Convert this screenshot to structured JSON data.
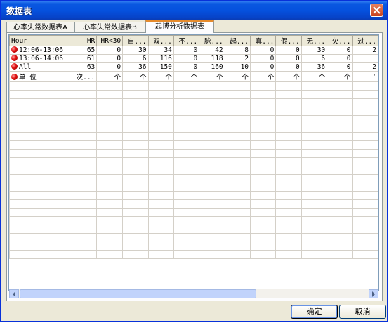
{
  "window": {
    "title": "数据表"
  },
  "tabs": [
    {
      "label": "心率失常数据表A"
    },
    {
      "label": "心率失常数据表B"
    },
    {
      "label": "起博分析数据表"
    }
  ],
  "table": {
    "columns": [
      "Hour",
      "HR",
      "HR<30",
      "自...",
      "双...",
      "不...",
      "脉...",
      "起...",
      "真...",
      "假...",
      "无...",
      "欠...",
      "过..."
    ],
    "rows": [
      [
        "12:06-13:06",
        "65",
        "0",
        "30",
        "34",
        "0",
        "42",
        "8",
        "0",
        "0",
        "30",
        "0",
        "2"
      ],
      [
        "13:06-14:06",
        "61",
        "0",
        "6",
        "116",
        "0",
        "118",
        "2",
        "0",
        "0",
        "6",
        "0",
        ""
      ],
      [
        "All",
        "63",
        "0",
        "36",
        "150",
        "0",
        "160",
        "10",
        "0",
        "0",
        "36",
        "0",
        "2"
      ],
      [
        "单 位",
        "次...",
        "个",
        "个",
        "个",
        "个",
        "个",
        "个",
        "个",
        "个",
        "个",
        "个",
        "'"
      ]
    ]
  },
  "buttons": {
    "ok": "确定",
    "cancel": "取消"
  },
  "colors": {
    "title_bar": "#0551de",
    "row_marker": "#e01010",
    "active_tab": "#e68b2c"
  }
}
